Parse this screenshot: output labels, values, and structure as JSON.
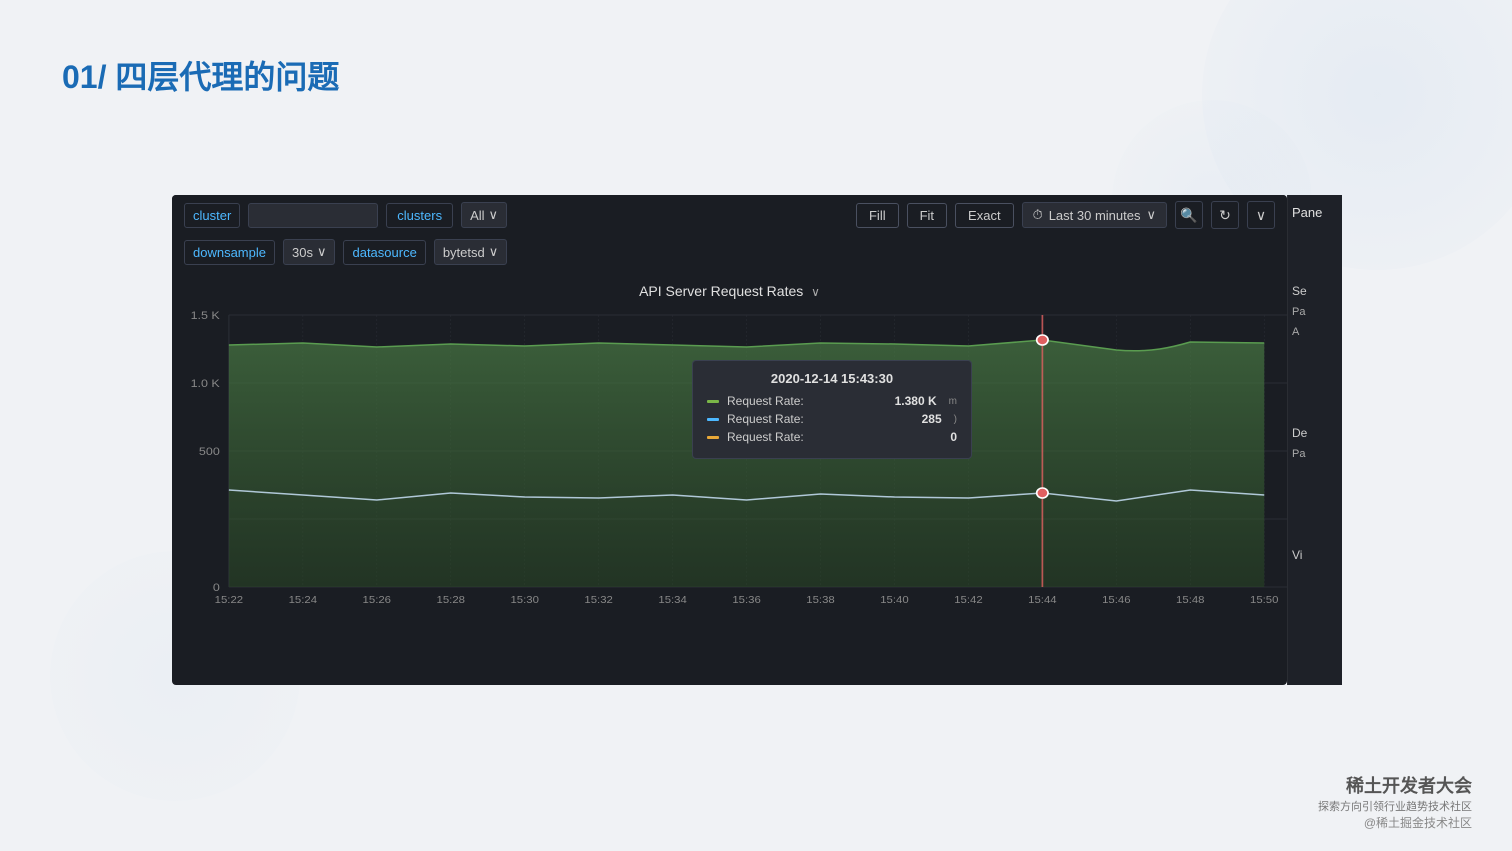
{
  "page": {
    "title": "01/ 四层代理的问题",
    "background_color": "#f0f2f5"
  },
  "toolbar": {
    "row1": {
      "cluster_label": "cluster",
      "cluster_input_placeholder": "",
      "clusters_label": "clusters",
      "all_dropdown": "All",
      "fill_btn": "Fill",
      "fit_btn": "Fit",
      "exact_btn": "Exact",
      "time_label": "Last 30 minutes",
      "panel_label": "Pane"
    },
    "row2": {
      "downsample_label": "downsample",
      "interval_dropdown": "30s",
      "datasource_label": "datasource",
      "datasource_dropdown": "bytetsd"
    }
  },
  "chart": {
    "title": "API Server Request Rates",
    "y_labels": [
      "1.5 K",
      "1.0 K",
      "500",
      "0"
    ],
    "x_labels": [
      "15:22",
      "15:24",
      "15:26",
      "15:28",
      "15:30",
      "15:32",
      "15:34",
      "15:36",
      "15:38",
      "15:40",
      "15:42",
      "15:44",
      "15:46",
      "15:48",
      "15:50"
    ],
    "tooltip": {
      "time": "2020-12-14 15:43:30",
      "rows": [
        {
          "color": "#7ab648",
          "label": "Request Rate:",
          "value": "1.380 K"
        },
        {
          "color": "#4db8ff",
          "label": "Request Rate:",
          "value": "285"
        },
        {
          "color": "#e8a838",
          "label": "Request Rate:",
          "value": "0"
        }
      ]
    }
  },
  "side_panel": {
    "title": "Panel",
    "section1": "Se",
    "pa_label": "Pa",
    "a_label": "A",
    "de_label": "De",
    "pa2_label": "Pa",
    "vi_label": "Vi"
  },
  "branding": {
    "title": "稀土开发者大会",
    "subtitle": "探索方向引领行业趋势技术社区",
    "handle": "@稀土掘金技术社区"
  },
  "icons": {
    "clock": "⏱",
    "search_minus": "🔍",
    "refresh": "↻",
    "chevron_down": "∨",
    "chevron_down_small": "⌄"
  }
}
